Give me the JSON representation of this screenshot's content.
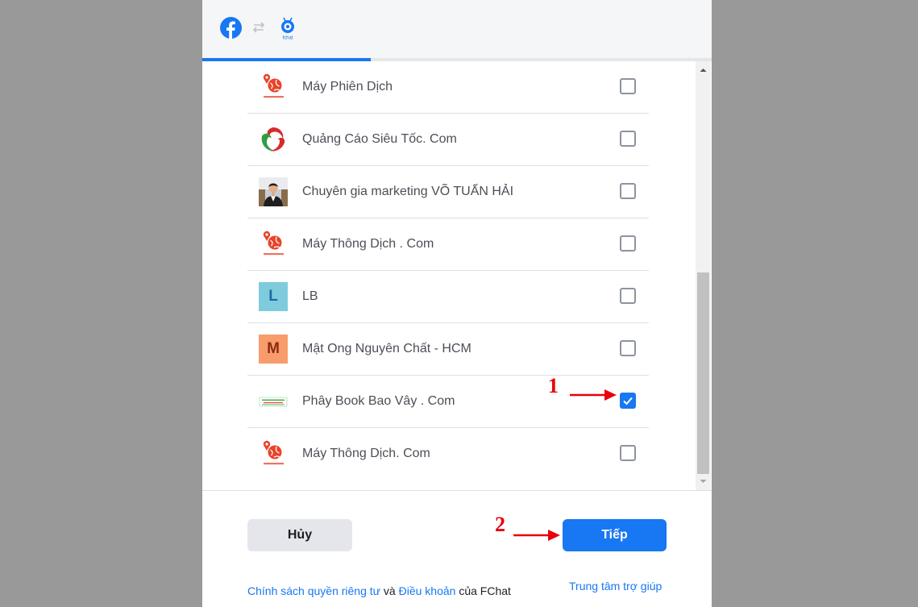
{
  "pages": [
    {
      "name": "Máy Phiên Dịch",
      "avatar": "globe-pin-logo-icon",
      "checked": false
    },
    {
      "name": "Quảng Cáo Siêu Tốc. Com",
      "avatar": "swirl-logo-icon",
      "checked": false
    },
    {
      "name": "Chuyên gia marketing VÕ TUẤN HẢI",
      "avatar": "person-photo-avatar",
      "checked": false
    },
    {
      "name": "Máy Thông Dịch . Com",
      "avatar": "globe-pin-logo-icon",
      "checked": false
    },
    {
      "name": "LB",
      "avatar": "letter-avatar",
      "letter": "L",
      "avatar_bg": "#7ecbdd",
      "avatar_fg": "#1b6aa0",
      "checked": false
    },
    {
      "name": "Mật Ong Nguyên Chất - HCM",
      "avatar": "letter-avatar",
      "letter": "M",
      "avatar_bg": "#f79c6a",
      "avatar_fg": "#8b2a10",
      "checked": false
    },
    {
      "name": "Phây Book Bao Vây . Com",
      "avatar": "banner-logo-icon",
      "checked": true
    },
    {
      "name": "Máy Thông Dịch. Com",
      "avatar": "globe-pin-logo-icon",
      "checked": false
    }
  ],
  "progress": 0.33,
  "buttons": {
    "cancel": "Hủy",
    "next": "Tiếp"
  },
  "footer": {
    "privacy": "Chính sách quyền riêng tư",
    "and": "và",
    "terms": "Điều khoản",
    "of_fchat": "của FChat",
    "help": "Trung tâm trợ giúp"
  },
  "annotations": {
    "step1": "1",
    "step2": "2"
  },
  "colors": {
    "accent": "#1877f2",
    "annotation": "#e8000b",
    "backdrop": "#999999"
  }
}
